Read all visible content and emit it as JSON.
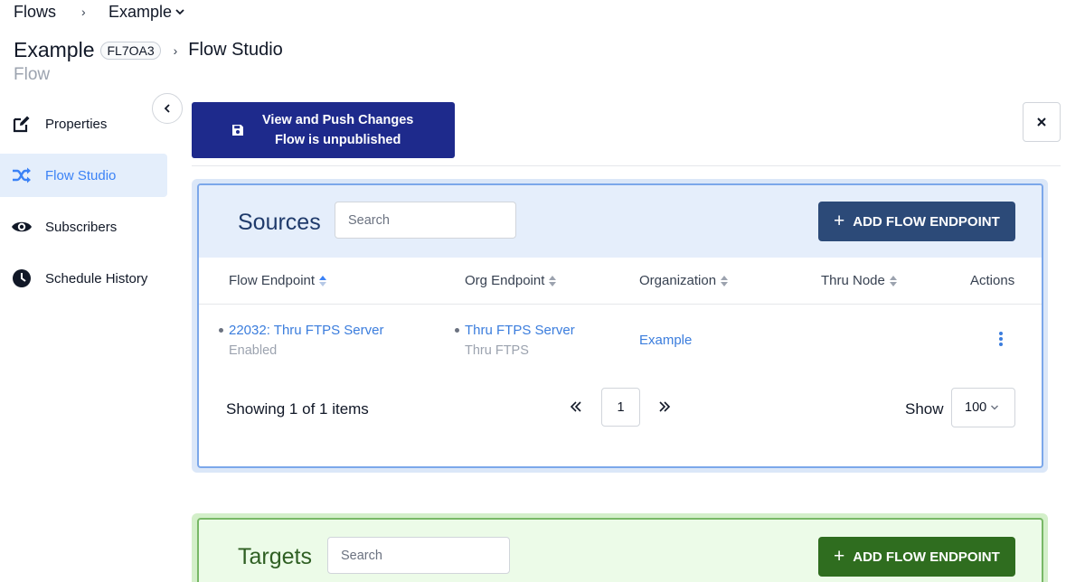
{
  "breadcrumb": {
    "root": "Flows",
    "separator": "›",
    "current": "Example"
  },
  "header": {
    "title": "Example",
    "badge": "FL7OA3",
    "separator": "›",
    "section": "Flow Studio",
    "subtitle": "Flow"
  },
  "sidebar": {
    "items": [
      {
        "label": "Properties",
        "icon": "edit-icon",
        "active": false
      },
      {
        "label": "Flow Studio",
        "icon": "shuffle-icon",
        "active": true
      },
      {
        "label": "Subscribers",
        "icon": "eye-icon",
        "active": false
      },
      {
        "label": "Schedule History",
        "icon": "clock-icon",
        "active": false
      }
    ]
  },
  "toolbar": {
    "push_line1": "View and Push Changes",
    "push_line2": "Flow is unpublished",
    "close_label": "×"
  },
  "colors": {
    "push_button": "#1e2a8c",
    "sources_add": "#2c4a78",
    "targets_add": "#2f6d1f",
    "link": "#3b7ddd",
    "active_nav": "#3b82f6"
  },
  "sources": {
    "title": "Sources",
    "search_placeholder": "Search",
    "add_label": "ADD FLOW ENDPOINT",
    "columns": [
      "Flow Endpoint",
      "Org Endpoint",
      "Organization",
      "Thru Node",
      "Actions"
    ],
    "rows": [
      {
        "flow_endpoint": "22032: Thru FTPS Server",
        "flow_status": "Enabled",
        "org_endpoint": "Thru FTPS Server",
        "org_type": "Thru FTPS",
        "organization": "Example",
        "thru_node": ""
      }
    ],
    "pagination": {
      "showing": "Showing 1 of 1 items",
      "page": "1",
      "show_label": "Show",
      "page_size": "100"
    }
  },
  "targets": {
    "title": "Targets",
    "search_placeholder": "Search",
    "add_label": "ADD FLOW ENDPOINT"
  }
}
